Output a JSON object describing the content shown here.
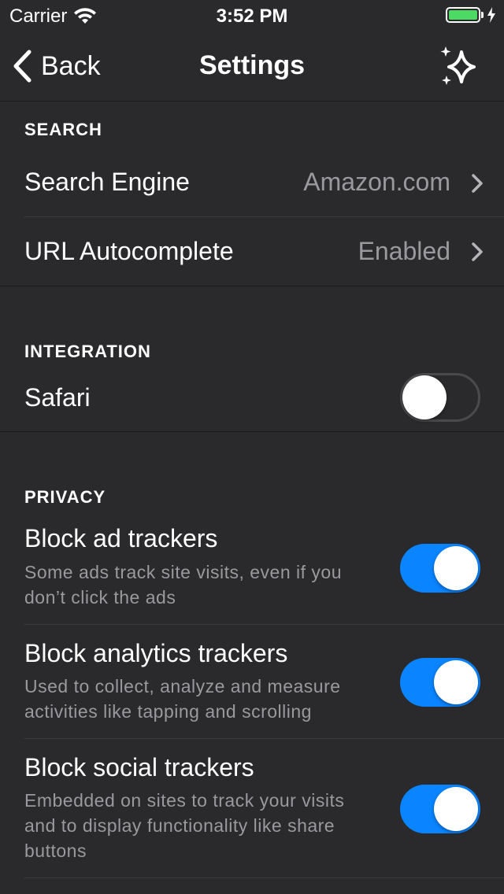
{
  "status_bar": {
    "carrier": "Carrier",
    "time": "3:52 PM",
    "battery_level": 1.0
  },
  "nav": {
    "back_label": "Back",
    "title": "Settings"
  },
  "search": {
    "header": "SEARCH",
    "rows": [
      {
        "label": "Search Engine",
        "value": "Amazon.com"
      },
      {
        "label": "URL Autocomplete",
        "value": "Enabled"
      }
    ]
  },
  "integration": {
    "header": "INTEGRATION",
    "safari": {
      "label": "Safari",
      "enabled": false
    }
  },
  "privacy": {
    "header": "PRIVACY",
    "items": [
      {
        "label": "Block ad trackers",
        "desc": "Some ads track site visits, even if you don’t click the ads",
        "enabled": true
      },
      {
        "label": "Block analytics trackers",
        "desc": "Used to collect, analyze and measure activities like tapping and scrolling",
        "enabled": true
      },
      {
        "label": "Block social trackers",
        "desc": "Embedded on sites to track your visits and to display functionality like share buttons",
        "enabled": true
      }
    ]
  },
  "colors": {
    "background": "#2a2a2c",
    "accent": "#0a84ff",
    "battery": "#4cd964",
    "secondary_text": "#9a9a9e"
  }
}
